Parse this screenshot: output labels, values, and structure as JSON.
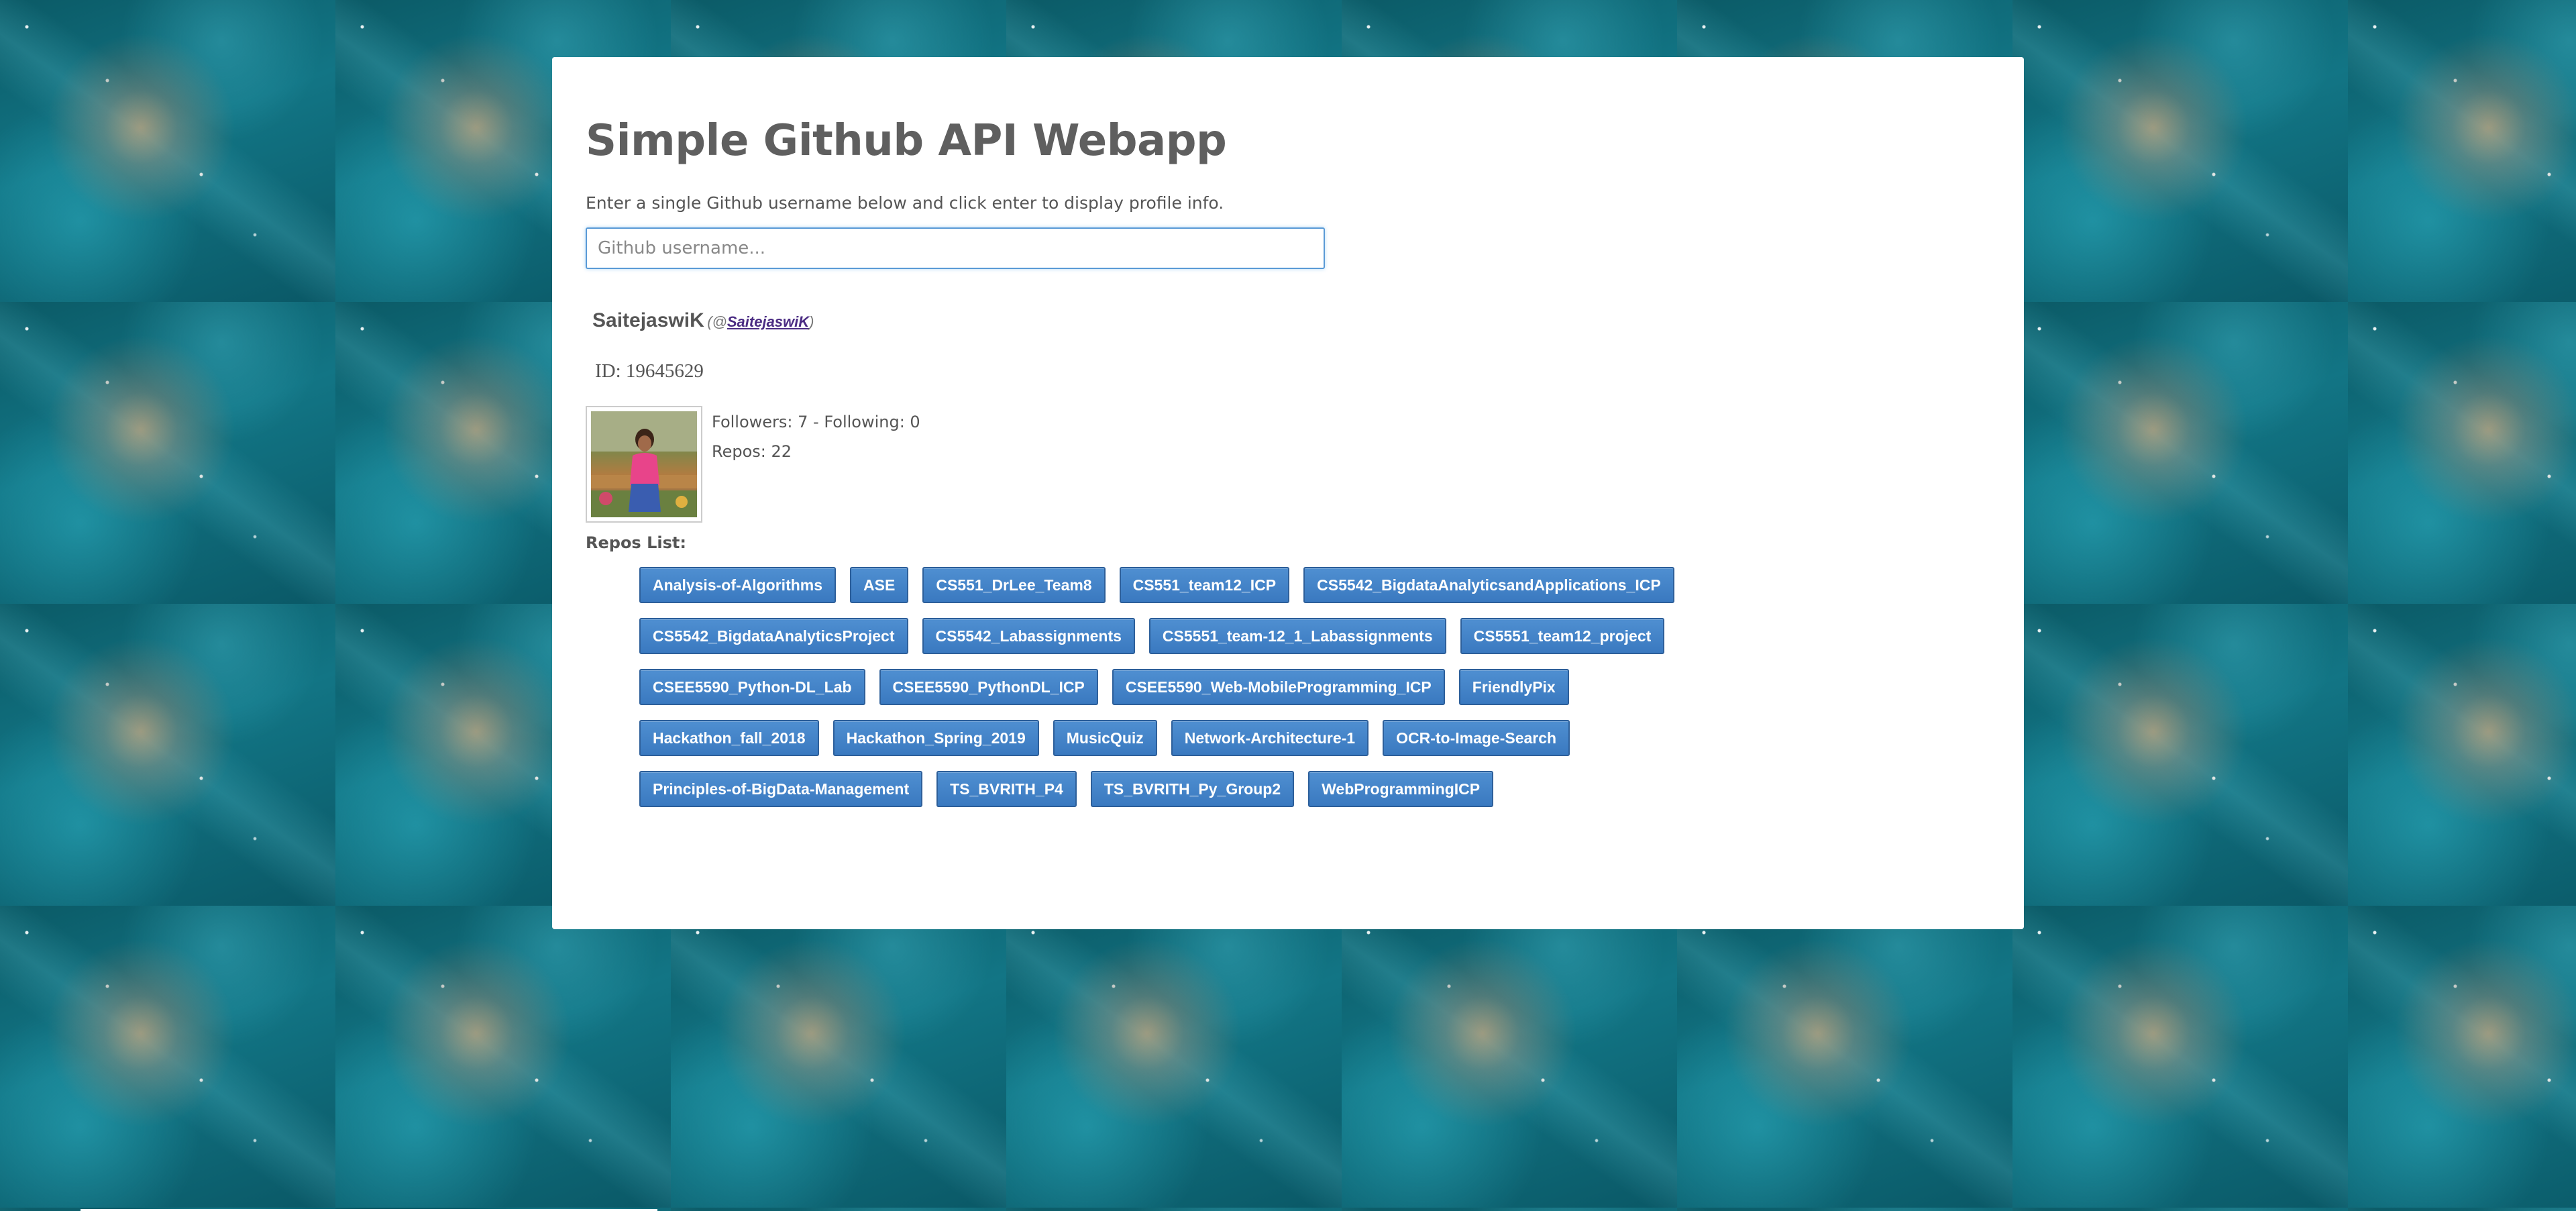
{
  "page": {
    "title": "Simple Github API Webapp",
    "instructions": "Enter a single Github username below and click enter to display profile info."
  },
  "search": {
    "placeholder": "Github username...",
    "value": ""
  },
  "profile": {
    "name": "SaitejaswiK",
    "handle_prefix": " (@",
    "login": "SaitejaswiK",
    "handle_suffix": ")",
    "id_text": "ID: 19645629",
    "followers_text": "Followers: 7 - Following: 0",
    "repos_text": "Repos: 22"
  },
  "repos": {
    "label": "Repos List:",
    "items": [
      "Analysis-of-Algorithms",
      "ASE",
      "CS551_DrLee_Team8",
      "CS551_team12_ICP",
      "CS5542_BigdataAnalyticsandApplications_ICP",
      "CS5542_BigdataAnalyticsProject",
      "CS5542_Labassignments",
      "CS5551_team-12_1_Labassignments",
      "CS5551_team12_project",
      "CSEE5590_Python-DL_Lab",
      "CSEE5590_PythonDL_ICP",
      "CSEE5590_Web-MobileProgramming_ICP",
      "FriendlyPix",
      "Hackathon_fall_2018",
      "Hackathon_Spring_2019",
      "MusicQuiz",
      "Network-Architecture-1",
      "OCR-to-Image-Search",
      "Principles-of-BigData-Management",
      "TS_BVRITH_P4",
      "TS_BVRITH_Py_Group2",
      "WebProgrammingICP"
    ]
  }
}
